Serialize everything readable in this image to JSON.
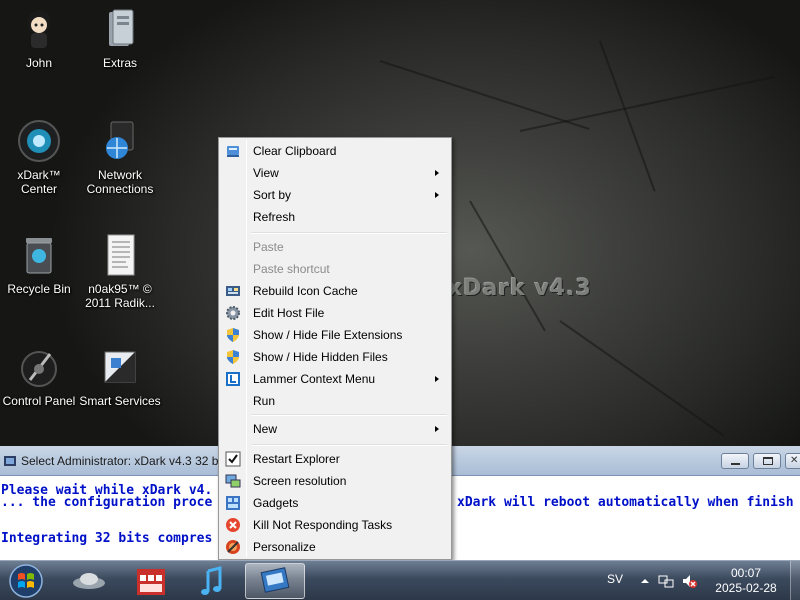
{
  "desktop": {
    "wallpaper_text": "xDark v4.3",
    "icons": [
      {
        "label": "John"
      },
      {
        "label": "Extras"
      },
      {
        "label": "xDark™ Center"
      },
      {
        "label": "Network Connections"
      },
      {
        "label": "Recycle Bin"
      },
      {
        "label": "n0ak95™ © 2011 Radik..."
      },
      {
        "label": "Control Panel"
      },
      {
        "label": "Smart Services"
      }
    ]
  },
  "console": {
    "title": "Select Administrator: xDark v4.3 32 bi... ...95",
    "lines": [
      "Please wait while xDark v4.",
      "... the configuration proce",
      "",
      "Integrating 32 bits compres"
    ],
    "right_line": "xDark will reboot automatically when finish"
  },
  "context_menu": {
    "items": [
      {
        "label": "Clear Clipboard",
        "icon": "clipboard-icon",
        "submenu": false,
        "disabled": false
      },
      {
        "label": "View",
        "icon": "",
        "submenu": true,
        "disabled": false
      },
      {
        "label": "Sort by",
        "icon": "",
        "submenu": true,
        "disabled": false
      },
      {
        "label": "Refresh",
        "icon": "",
        "submenu": false,
        "disabled": false
      },
      {
        "label": "Paste",
        "icon": "",
        "submenu": false,
        "disabled": true
      },
      {
        "label": "Paste shortcut",
        "icon": "",
        "submenu": false,
        "disabled": true
      },
      {
        "label": "Rebuild Icon Cache",
        "icon": "refresh-cache-icon",
        "submenu": false,
        "disabled": false
      },
      {
        "label": "Edit Host File",
        "icon": "gear-icon",
        "submenu": false,
        "disabled": false
      },
      {
        "label": "Show / Hide File Extensions",
        "icon": "shield-icon",
        "submenu": false,
        "disabled": false
      },
      {
        "label": "Show / Hide Hidden Files",
        "icon": "shield-icon",
        "submenu": false,
        "disabled": false
      },
      {
        "label": "Lammer Context Menu",
        "icon": "l-badge-icon",
        "submenu": true,
        "disabled": false
      },
      {
        "label": "Run",
        "icon": "",
        "submenu": false,
        "disabled": false
      },
      {
        "label": "New",
        "icon": "",
        "submenu": true,
        "disabled": false
      },
      {
        "label": "Restart Explorer",
        "icon": "checkmark-icon",
        "submenu": false,
        "disabled": false
      },
      {
        "label": "Screen resolution",
        "icon": "display-icon",
        "submenu": false,
        "disabled": false
      },
      {
        "label": "Gadgets",
        "icon": "gadgets-icon",
        "submenu": false,
        "disabled": false
      },
      {
        "label": "Kill Not Responding Tasks",
        "icon": "kill-task-icon",
        "submenu": false,
        "disabled": false
      },
      {
        "label": "Personalize",
        "icon": "personalize-icon",
        "submenu": false,
        "disabled": false
      }
    ]
  },
  "taskbar": {
    "language": "SV",
    "time": "00:07",
    "date": "2025-02-28",
    "pinned": [
      "browser-icon",
      "store-icon",
      "itunes-icon",
      "explorer-icon"
    ]
  },
  "colors": {
    "console_text": "#0010c8",
    "menu_background": "#f1f1f1",
    "taskbar": "#3c4a5e"
  }
}
